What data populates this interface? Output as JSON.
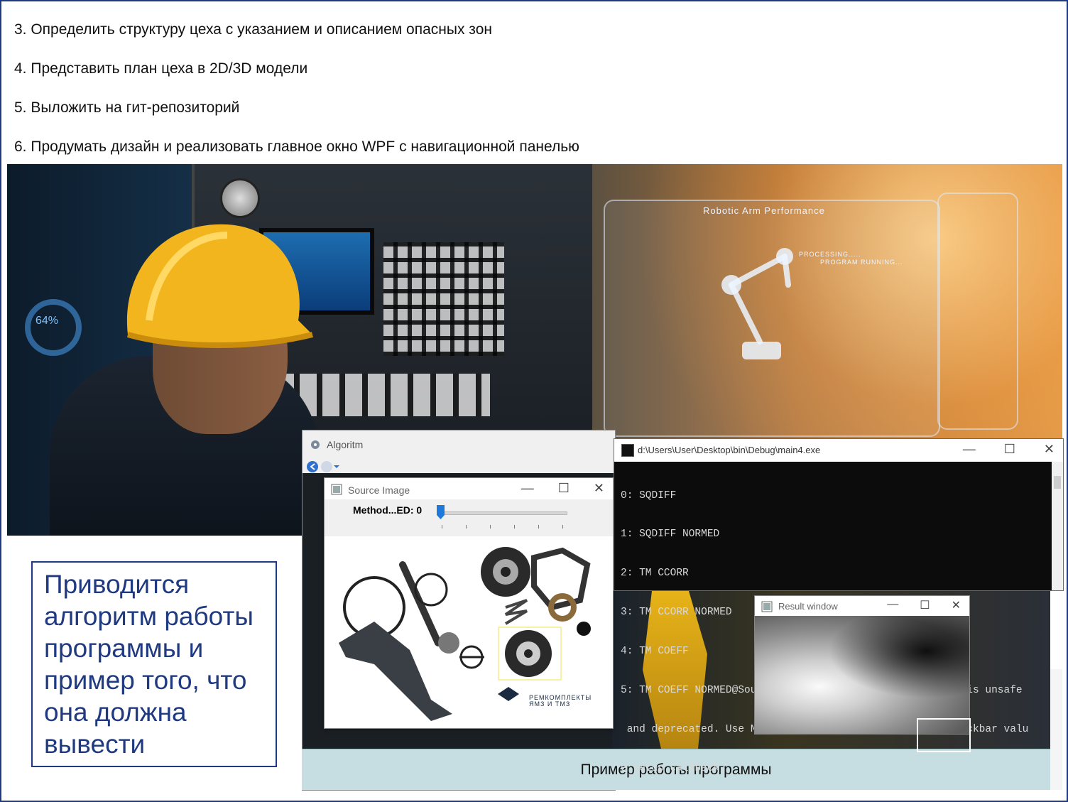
{
  "tasks": [
    "3. Определить структуру цеха с указанием и описанием опасных зон",
    "4. Представить план цеха в 2D/3D модели",
    "5. Выложить на гит-репозиторий",
    "6. Продумать дизайн и реализовать главное окно WPF с навигационной панелью"
  ],
  "hero": {
    "holo_title": "Robotic Arm Performance",
    "holo_processing": "PROCESSING.....",
    "holo_running": "PROGRAM RUNNING...",
    "gauge_value": "64%"
  },
  "algoritm_window": {
    "title": "Algoritm",
    "caption": "Пример работы программы"
  },
  "source_window": {
    "title": "Source Image",
    "trackbar_label": "Method...ED: 0",
    "trackbar_value_fraction": 0,
    "brand_line1": "РЕМКОМПЛЕКТЫ",
    "brand_line2": "ЯМЗ И ТМЗ"
  },
  "console_window": {
    "title": "d:\\Users\\User\\Desktop\\bin\\Debug\\main4.exe",
    "lines": [
      "0: SQDIFF",
      "1: SQDIFF NORMED",
      "2: TM CCORR",
      "3: TM CCORR NORMED",
      "4: TM COEFF",
      "5: TM COEFF NORMED@Source Image): Using 'value' pointer is unsafe",
      " and deprecated. Use NULL as value pointer. To fetch trackbar valu",
      "e setup callback."
    ]
  },
  "result_window": {
    "title": "Result window"
  },
  "window_controls": {
    "minimize": "—",
    "maximize": "☐",
    "close": "✕"
  },
  "callout": {
    "text": "Приводится алгоритм работы программы и пример того, что она должна вывести"
  }
}
